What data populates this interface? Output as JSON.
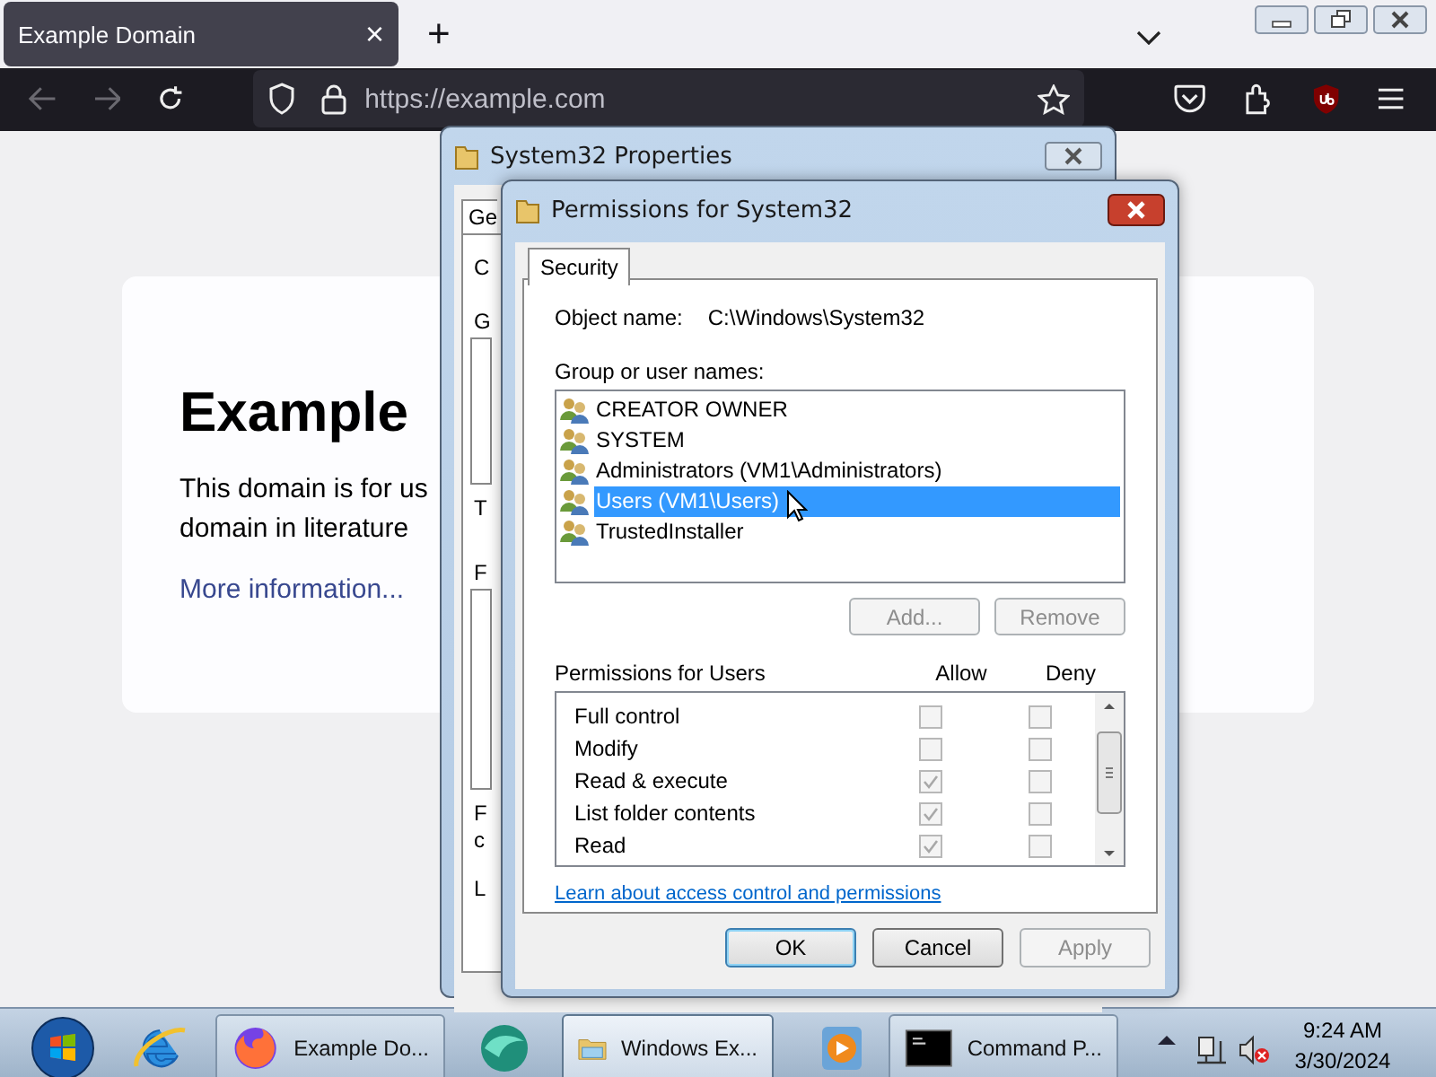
{
  "browser": {
    "tab": {
      "title": "Example Domain",
      "close": "×"
    },
    "new_tab": "+",
    "url": "https://example.com"
  },
  "page": {
    "heading": "Example",
    "paragraph_lines": [
      "This domain is for us",
      "domain in literature"
    ],
    "link": "More information..."
  },
  "properties_window": {
    "title": "System32 Properties",
    "tab": "Ge",
    "fragments": [
      "C",
      "G",
      "T",
      "F",
      "F",
      "c",
      "L"
    ]
  },
  "permissions_window": {
    "title": "Permissions for System32",
    "tab": "Security",
    "object_label": "Object name:",
    "object_value": "C:\\Windows\\System32",
    "group_label": "Group or user names:",
    "users": [
      {
        "name": "CREATOR OWNER",
        "selected": false
      },
      {
        "name": "SYSTEM",
        "selected": false
      },
      {
        "name": "Administrators (VM1\\Administrators)",
        "selected": false
      },
      {
        "name": "Users (VM1\\Users)",
        "selected": true
      },
      {
        "name": "TrustedInstaller",
        "selected": false
      }
    ],
    "user_buttons": [
      {
        "label": "Add...",
        "disabled": true
      },
      {
        "label": "Remove",
        "disabled": true
      }
    ],
    "permissions_label": "Permissions for Users",
    "allow_label": "Allow",
    "deny_label": "Deny",
    "permissions": [
      {
        "name": "Full control",
        "allow": false,
        "deny": false
      },
      {
        "name": "Modify",
        "allow": false,
        "deny": false
      },
      {
        "name": "Read & execute",
        "allow": true,
        "deny": false
      },
      {
        "name": "List folder contents",
        "allow": true,
        "deny": false
      },
      {
        "name": "Read",
        "allow": true,
        "deny": false
      }
    ],
    "link": "Learn about access control and permissions",
    "buttons": [
      {
        "label": "OK",
        "disabled": false
      },
      {
        "label": "Cancel",
        "disabled": false
      },
      {
        "label": "Apply",
        "disabled": true
      }
    ]
  },
  "taskbar": {
    "windows": [
      {
        "label": "Example Do...",
        "selected": false
      },
      {
        "label": "Windows Ex...",
        "selected": true
      },
      {
        "label": "Command P...",
        "selected": false
      }
    ],
    "time": "9:24 AM",
    "date": "3/30/2024"
  }
}
